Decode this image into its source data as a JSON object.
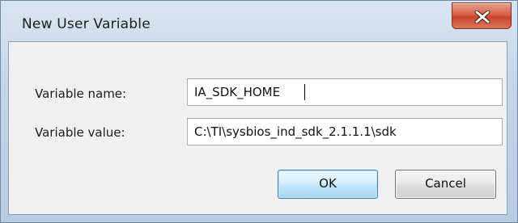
{
  "dialog": {
    "title": "New User Variable",
    "close_symbol": "close-icon"
  },
  "fields": {
    "name_label": "Variable name:",
    "name_value": "IA_SDK_HOME",
    "value_label": "Variable value:",
    "value_value": "C:\\TI\\sysbios_ind_sdk_2.1.1.1\\sdk"
  },
  "buttons": {
    "ok_label": "OK",
    "cancel_label": "Cancel"
  },
  "colors": {
    "close_button": "#d7614a",
    "default_button_border": "#3c7fb1"
  }
}
